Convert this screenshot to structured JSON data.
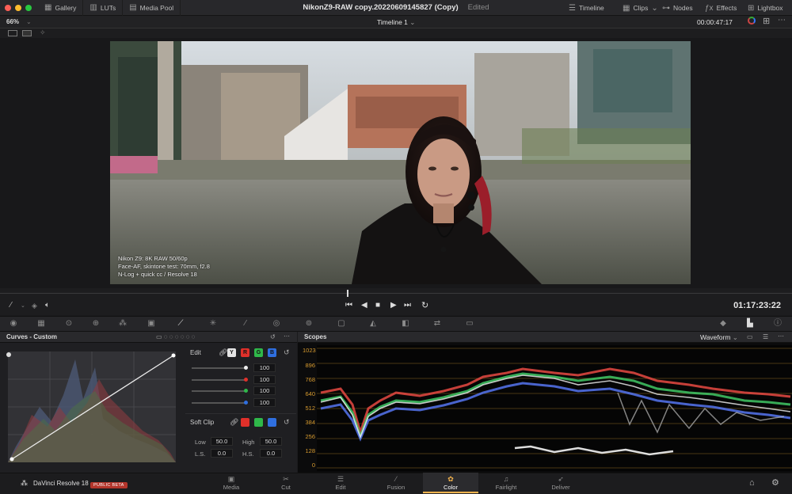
{
  "topbar": {
    "gallery": "Gallery",
    "luts": "LUTs",
    "media_pool": "Media Pool",
    "project_title": "NikonZ9-RAW copy.20220609145827 (Copy)",
    "edited": "Edited",
    "timeline": "Timeline",
    "clips": "Clips",
    "nodes": "Nodes",
    "effects": "Effects",
    "lightbox": "Lightbox"
  },
  "viewer": {
    "zoom": "66%",
    "timeline_name": "Timeline 1",
    "source_timecode": "00:00:47:17",
    "overlay": [
      "Nikon Z9: 8K RAW 50/60p",
      "Face-AF, skintone test: 70mm, f2.8",
      "N-Log + quick cc / Resolve 18"
    ]
  },
  "transport": {
    "timecode": "01:17:23:22"
  },
  "curves": {
    "title": "Curves - Custom",
    "edit_label": "Edit",
    "channels": [
      "Y",
      "R",
      "G",
      "B"
    ],
    "intensities": [
      "100",
      "100",
      "100",
      "100"
    ],
    "soft_clip_label": "Soft Clip",
    "low_label": "Low",
    "low_value": "50.0",
    "high_label": "High",
    "high_value": "50.0",
    "ls_label": "L.S.",
    "ls_value": "0.0",
    "hs_label": "H.S.",
    "hs_value": "0.0"
  },
  "scopes": {
    "title": "Scopes",
    "mode": "Waveform",
    "y_ticks": [
      "1023",
      "896",
      "768",
      "640",
      "512",
      "384",
      "256",
      "128",
      "0"
    ]
  },
  "app": {
    "name": "DaVinci Resolve 18",
    "badge": "PUBLIC BETA"
  },
  "pages": [
    "Media",
    "Cut",
    "Edit",
    "Fusion",
    "Color",
    "Fairlight",
    "Deliver"
  ],
  "colors": {
    "accent": "#f3b34d",
    "red_channel": "#e0302a",
    "green_channel": "#2fb84a",
    "blue_channel": "#2f6fe0",
    "badge": "#b3352b"
  }
}
